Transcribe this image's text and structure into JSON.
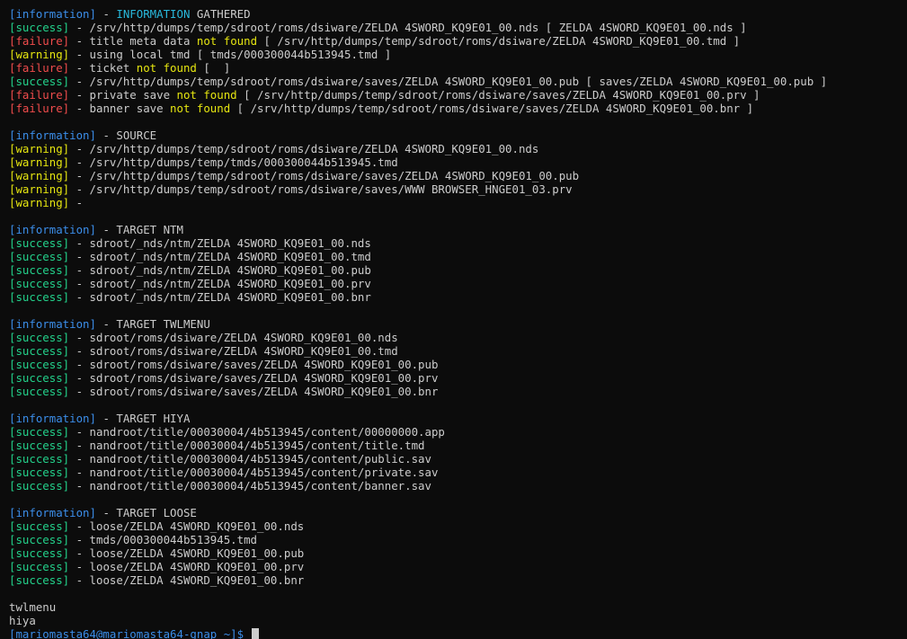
{
  "colors": {
    "background": "#0c0c0c",
    "foreground": "#cccccc",
    "information": "#3b8eea",
    "success": "#23d18b",
    "failure": "#f14c4c",
    "warning": "#e5e510",
    "info_highlight": "#29b8db"
  },
  "lines": [
    {
      "kind": "log",
      "level": "information",
      "parts": [
        {
          "t": " - "
        },
        {
          "t": "INFORMATION",
          "c": "hl-info"
        },
        {
          "t": " GATHERED"
        }
      ]
    },
    {
      "kind": "log",
      "level": "success",
      "parts": [
        {
          "t": " - /srv/http/dumps/temp/sdroot/roms/dsiware/ZELDA 4SWORD_KQ9E01_00.nds [ ZELDA 4SWORD_KQ9E01_00.nds ]"
        }
      ]
    },
    {
      "kind": "log",
      "level": "failure",
      "parts": [
        {
          "t": " - title meta data "
        },
        {
          "t": "not found",
          "c": "hl-warn"
        },
        {
          "t": " [ /srv/http/dumps/temp/sdroot/roms/dsiware/ZELDA 4SWORD_KQ9E01_00.tmd ]"
        }
      ]
    },
    {
      "kind": "log",
      "level": "warning",
      "parts": [
        {
          "t": " - using local tmd [ tmds/000300044b513945.tmd ]"
        }
      ]
    },
    {
      "kind": "log",
      "level": "failure",
      "parts": [
        {
          "t": " - ticket "
        },
        {
          "t": "not found",
          "c": "hl-warn"
        },
        {
          "t": " [  ]"
        }
      ]
    },
    {
      "kind": "log",
      "level": "success",
      "parts": [
        {
          "t": " - /srv/http/dumps/temp/sdroot/roms/dsiware/saves/ZELDA 4SWORD_KQ9E01_00.pub [ saves/ZELDA 4SWORD_KQ9E01_00.pub ]"
        }
      ]
    },
    {
      "kind": "log",
      "level": "failure",
      "parts": [
        {
          "t": " - private save "
        },
        {
          "t": "not found",
          "c": "hl-warn"
        },
        {
          "t": " [ /srv/http/dumps/temp/sdroot/roms/dsiware/saves/ZELDA 4SWORD_KQ9E01_00.prv ]"
        }
      ]
    },
    {
      "kind": "log",
      "level": "failure",
      "parts": [
        {
          "t": " - banner save "
        },
        {
          "t": "not found",
          "c": "hl-warn"
        },
        {
          "t": " [ /srv/http/dumps/temp/sdroot/roms/dsiware/saves/ZELDA 4SWORD_KQ9E01_00.bnr ]"
        }
      ]
    },
    {
      "kind": "blank"
    },
    {
      "kind": "log",
      "level": "information",
      "parts": [
        {
          "t": " - SOURCE"
        }
      ]
    },
    {
      "kind": "log",
      "level": "warning",
      "parts": [
        {
          "t": " - /srv/http/dumps/temp/sdroot/roms/dsiware/ZELDA 4SWORD_KQ9E01_00.nds"
        }
      ]
    },
    {
      "kind": "log",
      "level": "warning",
      "parts": [
        {
          "t": " - /srv/http/dumps/temp/tmds/000300044b513945.tmd"
        }
      ]
    },
    {
      "kind": "log",
      "level": "warning",
      "parts": [
        {
          "t": " - /srv/http/dumps/temp/sdroot/roms/dsiware/saves/ZELDA 4SWORD_KQ9E01_00.pub"
        }
      ]
    },
    {
      "kind": "log",
      "level": "warning",
      "parts": [
        {
          "t": " - /srv/http/dumps/temp/sdroot/roms/dsiware/saves/WWW BROWSER_HNGE01_03.prv"
        }
      ]
    },
    {
      "kind": "log",
      "level": "warning",
      "parts": [
        {
          "t": " -"
        }
      ]
    },
    {
      "kind": "blank"
    },
    {
      "kind": "log",
      "level": "information",
      "parts": [
        {
          "t": " - TARGET NTM"
        }
      ]
    },
    {
      "kind": "log",
      "level": "success",
      "parts": [
        {
          "t": " - sdroot/_nds/ntm/ZELDA 4SWORD_KQ9E01_00.nds"
        }
      ]
    },
    {
      "kind": "log",
      "level": "success",
      "parts": [
        {
          "t": " - sdroot/_nds/ntm/ZELDA 4SWORD_KQ9E01_00.tmd"
        }
      ]
    },
    {
      "kind": "log",
      "level": "success",
      "parts": [
        {
          "t": " - sdroot/_nds/ntm/ZELDA 4SWORD_KQ9E01_00.pub"
        }
      ]
    },
    {
      "kind": "log",
      "level": "success",
      "parts": [
        {
          "t": " - sdroot/_nds/ntm/ZELDA 4SWORD_KQ9E01_00.prv"
        }
      ]
    },
    {
      "kind": "log",
      "level": "success",
      "parts": [
        {
          "t": " - sdroot/_nds/ntm/ZELDA 4SWORD_KQ9E01_00.bnr"
        }
      ]
    },
    {
      "kind": "blank"
    },
    {
      "kind": "log",
      "level": "information",
      "parts": [
        {
          "t": " - TARGET TWLMENU"
        }
      ]
    },
    {
      "kind": "log",
      "level": "success",
      "parts": [
        {
          "t": " - sdroot/roms/dsiware/ZELDA 4SWORD_KQ9E01_00.nds"
        }
      ]
    },
    {
      "kind": "log",
      "level": "success",
      "parts": [
        {
          "t": " - sdroot/roms/dsiware/ZELDA 4SWORD_KQ9E01_00.tmd"
        }
      ]
    },
    {
      "kind": "log",
      "level": "success",
      "parts": [
        {
          "t": " - sdroot/roms/dsiware/saves/ZELDA 4SWORD_KQ9E01_00.pub"
        }
      ]
    },
    {
      "kind": "log",
      "level": "success",
      "parts": [
        {
          "t": " - sdroot/roms/dsiware/saves/ZELDA 4SWORD_KQ9E01_00.prv"
        }
      ]
    },
    {
      "kind": "log",
      "level": "success",
      "parts": [
        {
          "t": " - sdroot/roms/dsiware/saves/ZELDA 4SWORD_KQ9E01_00.bnr"
        }
      ]
    },
    {
      "kind": "blank"
    },
    {
      "kind": "log",
      "level": "information",
      "parts": [
        {
          "t": " - TARGET HIYA"
        }
      ]
    },
    {
      "kind": "log",
      "level": "success",
      "parts": [
        {
          "t": " - nandroot/title/00030004/4b513945/content/00000000.app"
        }
      ]
    },
    {
      "kind": "log",
      "level": "success",
      "parts": [
        {
          "t": " - nandroot/title/00030004/4b513945/content/title.tmd"
        }
      ]
    },
    {
      "kind": "log",
      "level": "success",
      "parts": [
        {
          "t": " - nandroot/title/00030004/4b513945/content/public.sav"
        }
      ]
    },
    {
      "kind": "log",
      "level": "success",
      "parts": [
        {
          "t": " - nandroot/title/00030004/4b513945/content/private.sav"
        }
      ]
    },
    {
      "kind": "log",
      "level": "success",
      "parts": [
        {
          "t": " - nandroot/title/00030004/4b513945/content/banner.sav"
        }
      ]
    },
    {
      "kind": "blank"
    },
    {
      "kind": "log",
      "level": "information",
      "parts": [
        {
          "t": " - TARGET LOOSE"
        }
      ]
    },
    {
      "kind": "log",
      "level": "success",
      "parts": [
        {
          "t": " - loose/ZELDA 4SWORD_KQ9E01_00.nds"
        }
      ]
    },
    {
      "kind": "log",
      "level": "success",
      "parts": [
        {
          "t": " - tmds/000300044b513945.tmd"
        }
      ]
    },
    {
      "kind": "log",
      "level": "success",
      "parts": [
        {
          "t": " - loose/ZELDA 4SWORD_KQ9E01_00.pub"
        }
      ]
    },
    {
      "kind": "log",
      "level": "success",
      "parts": [
        {
          "t": " - loose/ZELDA 4SWORD_KQ9E01_00.prv"
        }
      ]
    },
    {
      "kind": "log",
      "level": "success",
      "parts": [
        {
          "t": " - loose/ZELDA 4SWORD_KQ9E01_00.bnr"
        }
      ]
    },
    {
      "kind": "blank"
    },
    {
      "kind": "plain",
      "text": "twlmenu"
    },
    {
      "kind": "plain",
      "text": "hiya"
    },
    {
      "kind": "prompt",
      "text": "[mariomasta64@mariomasta64-gnap ~]$"
    }
  ]
}
